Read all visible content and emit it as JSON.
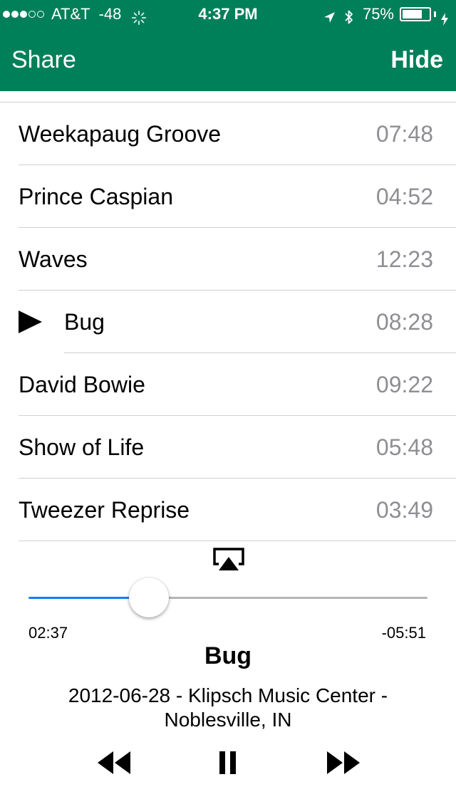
{
  "status_bar": {
    "signal_dots": [
      "filled",
      "filled",
      "filled",
      "empty",
      "empty"
    ],
    "carrier": "AT&T",
    "signal_strength": "-48",
    "time": "4:37 PM",
    "battery_percent": "75%",
    "battery_level": 0.75
  },
  "nav": {
    "share_label": "Share",
    "hide_label": "Hide"
  },
  "tracks": [
    {
      "title": "Weekapaug Groove",
      "duration": "07:48",
      "playing": false
    },
    {
      "title": "Prince Caspian",
      "duration": "04:52",
      "playing": false
    },
    {
      "title": "Waves",
      "duration": "12:23",
      "playing": false
    },
    {
      "title": "Bug",
      "duration": "08:28",
      "playing": true
    },
    {
      "title": "David Bowie",
      "duration": "09:22",
      "playing": false
    },
    {
      "title": "Show of Life",
      "duration": "05:48",
      "playing": false
    },
    {
      "title": "Tweezer Reprise",
      "duration": "03:49",
      "playing": false
    }
  ],
  "player": {
    "elapsed": "02:37",
    "remaining": "-05:51",
    "progress_fraction": 0.3,
    "title": "Bug",
    "show": "2012-06-28 - Klipsch Music Center - Noblesville, IN"
  },
  "colors": {
    "header_bg": "#008059",
    "progress": "#147efb",
    "duration_text": "#8e8e93"
  },
  "icons": {
    "airplay": "airplay-icon",
    "rewind": "rewind-icon",
    "pause": "pause-icon",
    "forward": "fast-forward-icon",
    "now_playing": "play-indicator-icon"
  }
}
